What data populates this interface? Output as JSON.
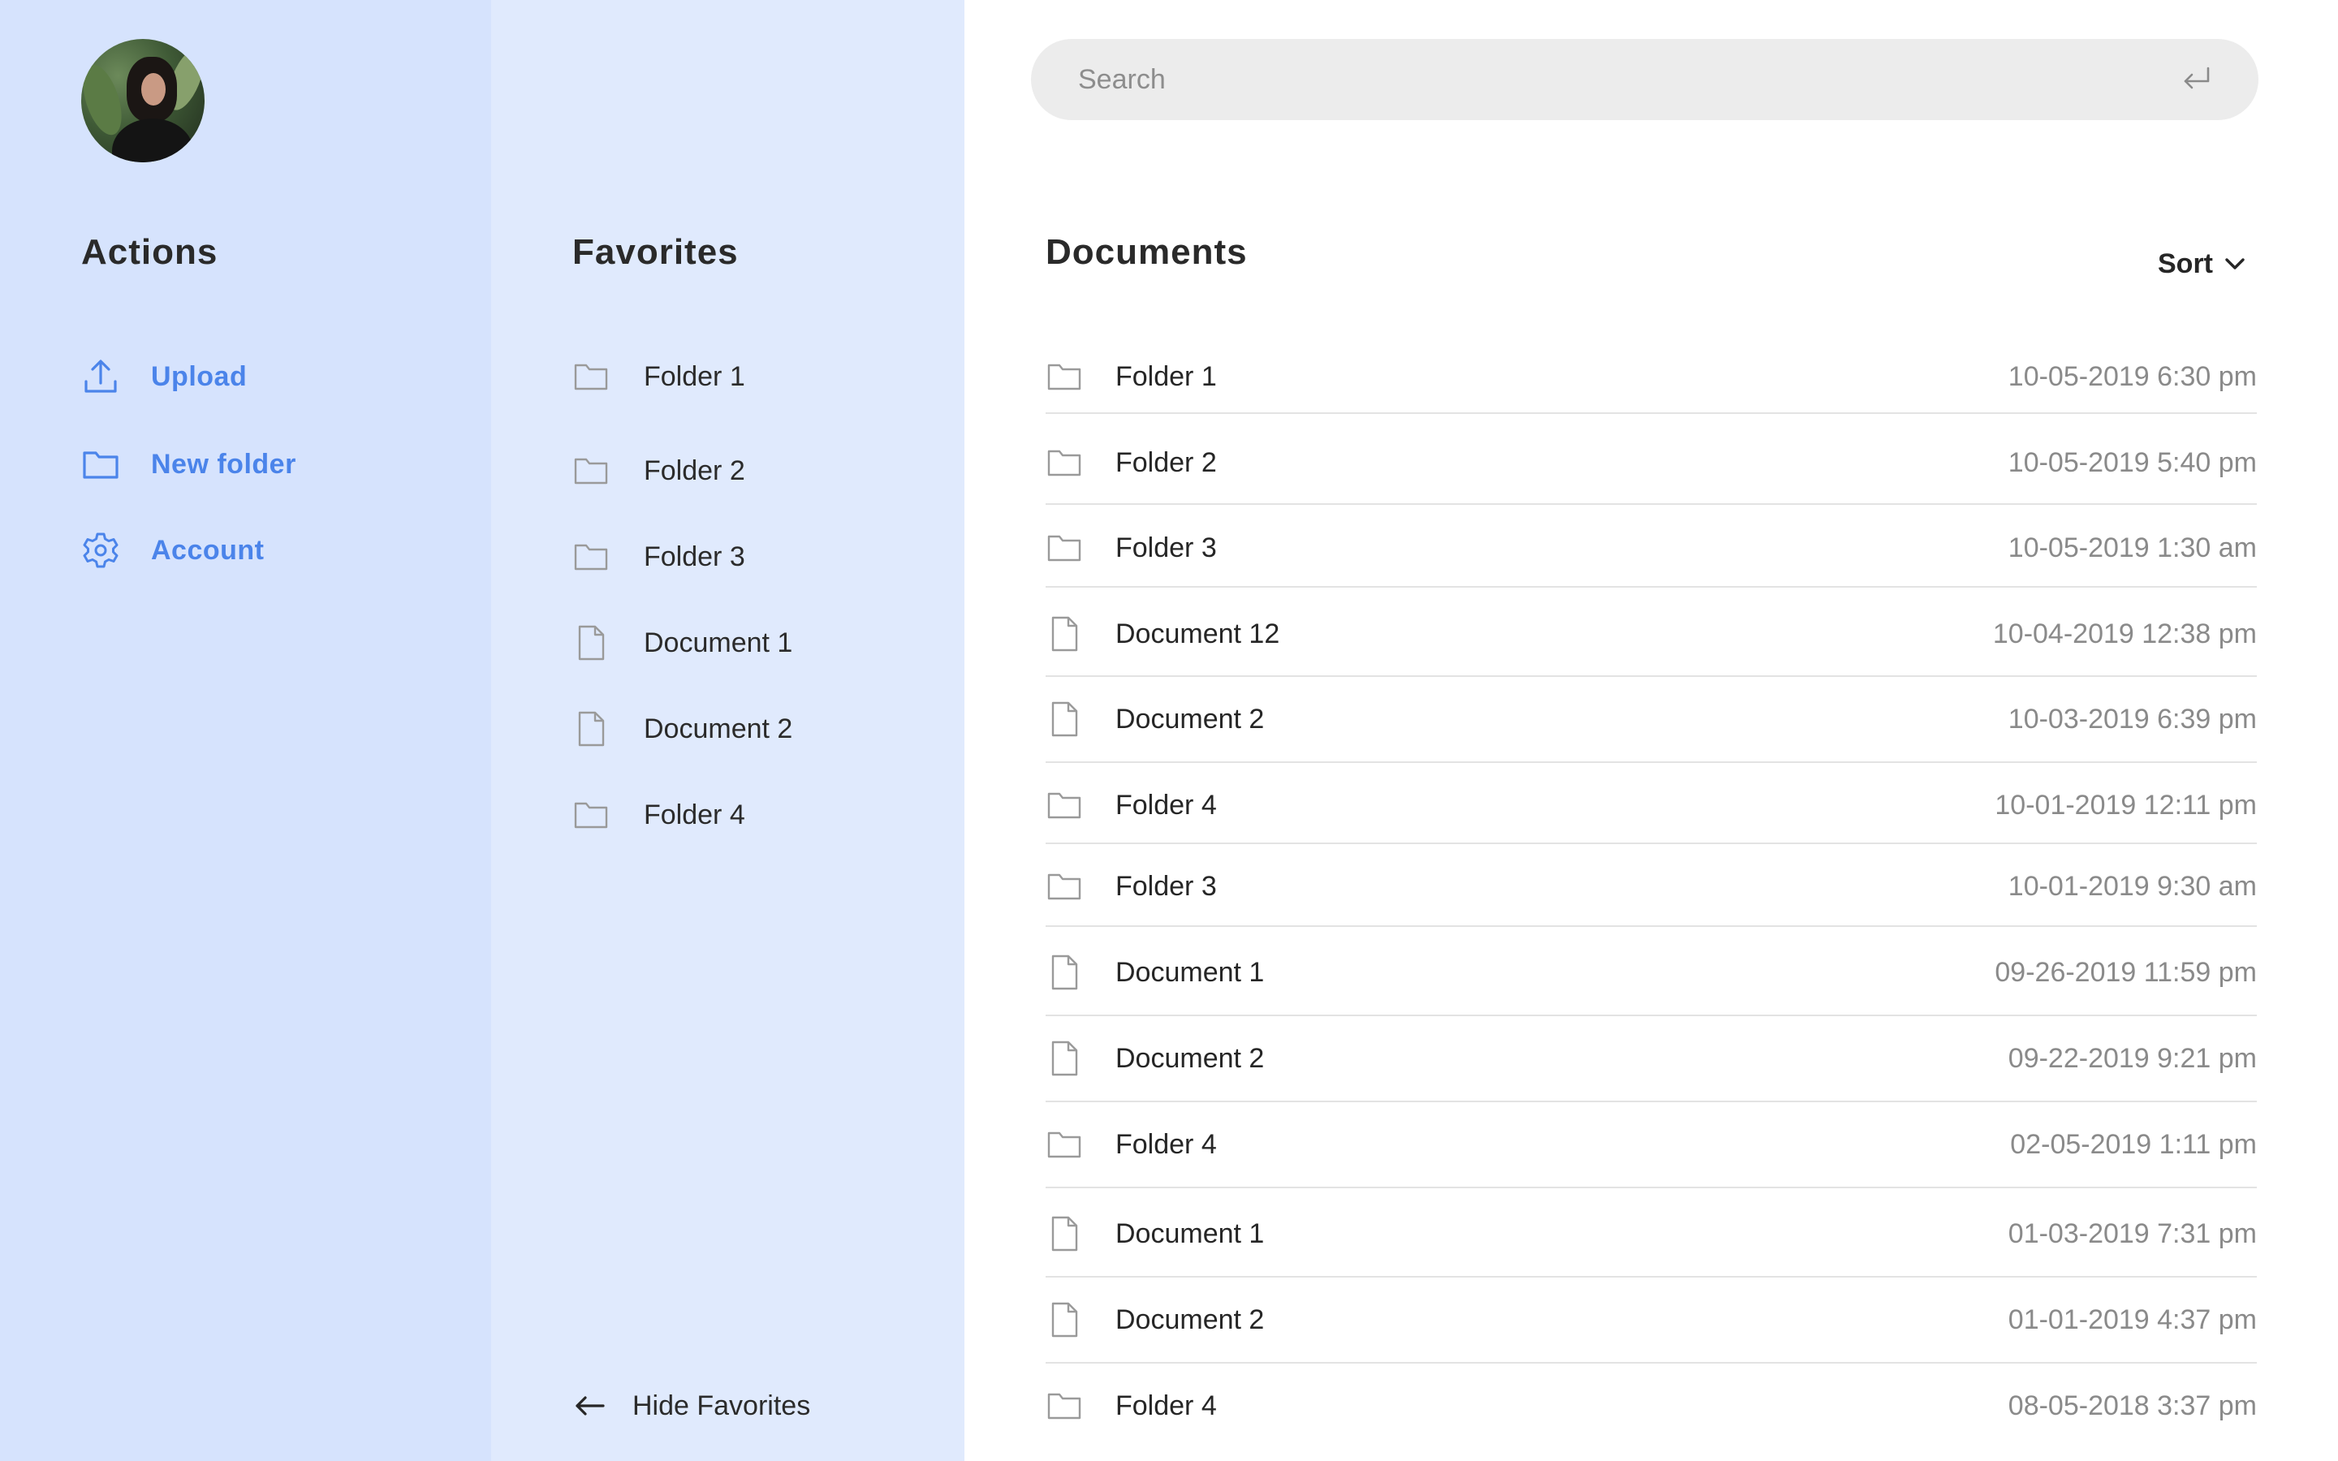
{
  "actions": {
    "title": "Actions",
    "items": [
      {
        "label": "Upload",
        "icon": "upload-icon"
      },
      {
        "label": "New folder",
        "icon": "folder-icon"
      },
      {
        "label": "Account",
        "icon": "gear-icon"
      }
    ]
  },
  "favorites": {
    "title": "Favorites",
    "items": [
      {
        "label": "Folder 1",
        "type": "folder"
      },
      {
        "label": "Folder 2",
        "type": "folder"
      },
      {
        "label": "Folder 3",
        "type": "folder"
      },
      {
        "label": "Document 1",
        "type": "document"
      },
      {
        "label": "Document 2",
        "type": "document"
      },
      {
        "label": "Folder 4",
        "type": "folder"
      }
    ],
    "hide_label": "Hide Favorites"
  },
  "documents": {
    "search_placeholder": "Search",
    "title": "Documents",
    "sort_label": "Sort",
    "rows": [
      {
        "name": "Folder 1",
        "type": "folder",
        "date": "10-05-2019 6:30 pm"
      },
      {
        "name": "Folder 2",
        "type": "folder",
        "date": "10-05-2019 5:40 pm"
      },
      {
        "name": "Folder 3",
        "type": "folder",
        "date": "10-05-2019 1:30 am"
      },
      {
        "name": "Document 12",
        "type": "document",
        "date": "10-04-2019 12:38 pm"
      },
      {
        "name": "Document 2",
        "type": "document",
        "date": "10-03-2019 6:39 pm"
      },
      {
        "name": "Folder 4",
        "type": "folder",
        "date": "10-01-2019 12:11 pm"
      },
      {
        "name": "Folder 3",
        "type": "folder",
        "date": "10-01-2019 9:30 am"
      },
      {
        "name": "Document 1",
        "type": "document",
        "date": "09-26-2019 11:59 pm"
      },
      {
        "name": "Document 2",
        "type": "document",
        "date": "09-22-2019 9:21 pm"
      },
      {
        "name": "Folder 4",
        "type": "folder",
        "date": "02-05-2019 1:11 pm"
      },
      {
        "name": "Document 1",
        "type": "document",
        "date": "01-03-2019 7:31 pm"
      },
      {
        "name": "Document 2",
        "type": "document",
        "date": "01-01-2019 4:37 pm"
      },
      {
        "name": "Folder 4",
        "type": "folder",
        "date": "08-05-2018 3:37 pm"
      }
    ]
  },
  "colors": {
    "actions_bg": "#d6e3fd",
    "favorites_bg": "#e0eafd",
    "accent": "#4b84ea",
    "search_bg": "#ececec",
    "muted_icon": "#9a9a9a"
  }
}
